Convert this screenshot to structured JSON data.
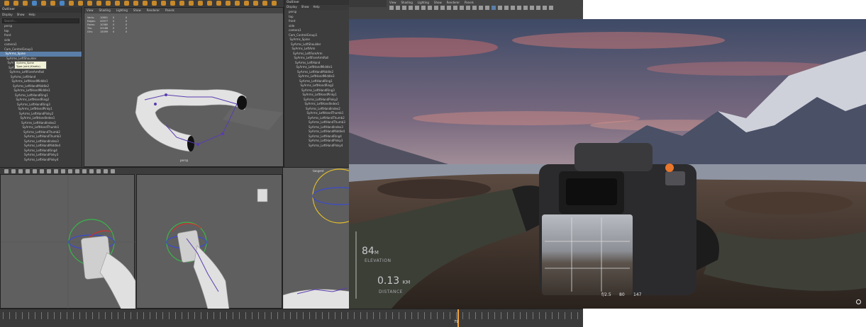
{
  "maya": {
    "outliner": {
      "title": "Outliner",
      "menu": [
        "Display",
        "Show",
        "Help"
      ],
      "search_placeholder": "Search...",
      "items": [
        "persp",
        "top",
        "front",
        "side",
        "camera1",
        "Cam_ControlGroup1",
        "SyArms_Spine",
        "SyArms_LeftShoulder",
        "SyArms_LeftArm",
        "SyArms_LeftForeArm",
        "SyArms_LeftForeArmRoll",
        "SyArms_LeftHand",
        "SyArms_LeftHandMiddle1",
        "SyArms_LeftHandMiddle2",
        "SyArms_LeftHandMiddle3",
        "SyArms_LeftHandRing1",
        "SyArms_LeftHandRing2",
        "SyArms_LeftHandRing3",
        "SyArms_LeftHandPinky1",
        "SyArms_LeftHandPinky2",
        "SyArms_LeftHandIndex1",
        "SyArms_LeftHandIndex2",
        "SyArms_LeftHandThumb1",
        "SyArms_LeftHandThumb2",
        "SyArms_LeftHandThumb3",
        "SyArms_LeftHandIndex3",
        "SyArms_LeftHandMiddle4",
        "SyArms_LeftHandRing4",
        "SyArms_LeftHandPinky3",
        "SyArms_LeftHandPinky4"
      ],
      "tooltip_line1": "SyArms_Spine",
      "tooltip_line2": "Type: joint (Kinetic)"
    },
    "viewport_menu": [
      "View",
      "Shading",
      "Lighting",
      "Show",
      "Renderer",
      "Panels"
    ],
    "hud": [
      {
        "label": "Verts:",
        "v1": "10801",
        "v2": "0",
        "v3": "0"
      },
      {
        "label": "Edges:",
        "v1": "20977",
        "v2": "0",
        "v3": "0"
      },
      {
        "label": "Faces:",
        "v1": "10360",
        "v2": "0",
        "v3": "0"
      },
      {
        "label": "Tris:",
        "v1": "20168",
        "v2": "0",
        "v3": "0"
      },
      {
        "label": "UVs:",
        "v1": "15099",
        "v2": "0",
        "v3": "0"
      }
    ],
    "viewport_label": "persp",
    "outliner2": {
      "title": "Outliner",
      "menu": [
        "Display",
        "Show",
        "Help"
      ]
    },
    "viewport_c_label": "tangent",
    "timeline_time": "79",
    "topbar_menu": [
      "View",
      "Shading",
      "Lighting",
      "Show",
      "Renderer",
      "Panels"
    ]
  },
  "game": {
    "elevation_value": "84",
    "elevation_unit": "M",
    "elevation_label": "ELEVATION",
    "distance_value": "0.13",
    "distance_unit": "KM",
    "distance_label": "DISTANCE",
    "aperture": "f/2.5",
    "shutter": "80",
    "focal": "147"
  },
  "colors": {
    "maya_bg": "#444444",
    "selection": "#5a7ea8",
    "timeline_cursor": "#f4a338",
    "camera_accent": "#e8762c"
  }
}
